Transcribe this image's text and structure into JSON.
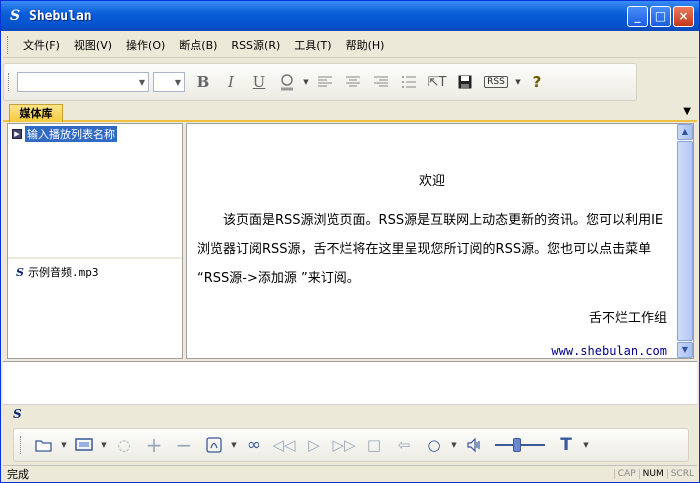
{
  "window": {
    "title": "Shebulan",
    "icon": "S"
  },
  "menu": [
    {
      "label": "文件(F)"
    },
    {
      "label": "视图(V)"
    },
    {
      "label": "操作(O)"
    },
    {
      "label": "断点(B)"
    },
    {
      "label": "RSS源(R)"
    },
    {
      "label": "工具(T)"
    },
    {
      "label": "帮助(H)"
    }
  ],
  "toolbar": {
    "rss_label": "RSS",
    "help_glyph": "?"
  },
  "tab": {
    "label": "媒体库"
  },
  "playlist": {
    "placeholder_item": "输入播放列表名称"
  },
  "files": {
    "item": "示例音频.mp3"
  },
  "content": {
    "title": "欢迎",
    "body": "该页面是RSS源浏览页面。RSS源是互联网上动态更新的资讯。您可以利用IE浏览器订阅RSS源，舌不烂将在这里呈现您所订阅的RSS源。您也可以点击菜单 “RSS源->添加源 ”来订阅。",
    "signature": "舌不烂工作组",
    "link": "www.shebulan.com"
  },
  "status": {
    "text": "完成",
    "cap": "CAP",
    "num": "NUM",
    "scrl": "SCRL"
  }
}
